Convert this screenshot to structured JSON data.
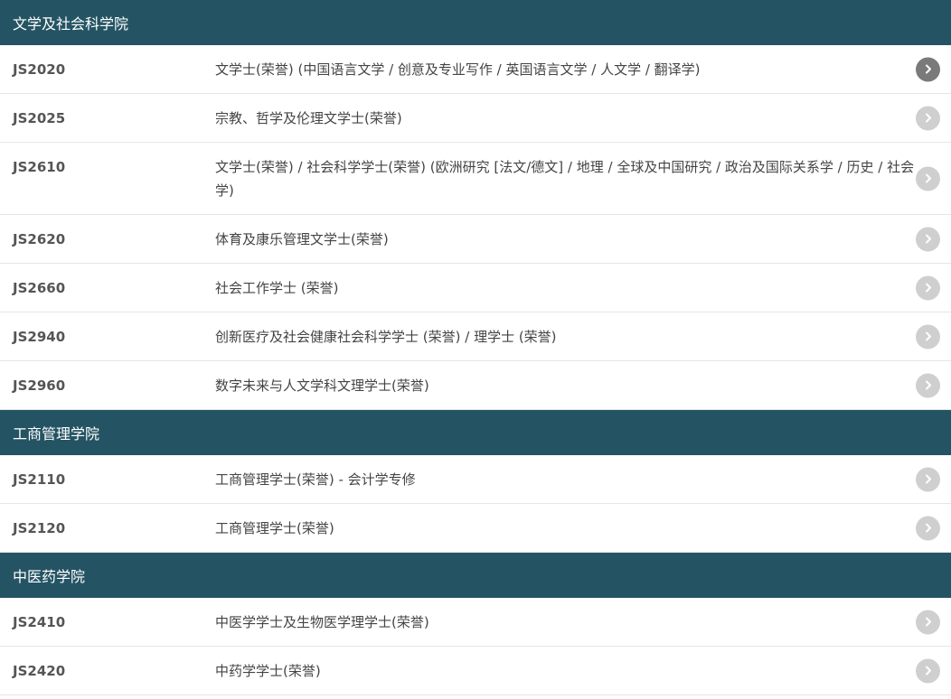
{
  "sections": [
    {
      "title": "文学及社会科学院",
      "items": [
        {
          "code": "JS2020",
          "title": "文学士(荣誉) (中国语言文学 / 创意及专业写作 / 英国语言文学 / 人文学 / 翻译学)"
        },
        {
          "code": "JS2025",
          "title": "宗教、哲学及伦理文学士(荣誉)"
        },
        {
          "code": "JS2610",
          "title": "文学士(荣誉) / 社会科学学士(荣誉) (欧洲研究 [法文/德文] / 地理 / 全球及中国研究 / 政治及国际关系学 / 历史 / 社会学)"
        },
        {
          "code": "JS2620",
          "title": "体育及康乐管理文学士(荣誉)"
        },
        {
          "code": "JS2660",
          "title": "社会工作学士 (荣誉)"
        },
        {
          "code": "JS2940",
          "title": "创新医疗及社会健康社会科学学士 (荣誉) / 理学士 (荣誉)"
        },
        {
          "code": "JS2960",
          "title": "数字未来与人文学科文理学士(荣誉)"
        }
      ]
    },
    {
      "title": "工商管理学院",
      "items": [
        {
          "code": "JS2110",
          "title": "工商管理学士(荣誉) - 会计学专修"
        },
        {
          "code": "JS2120",
          "title": "工商管理学士(荣誉)"
        }
      ]
    },
    {
      "title": "中医药学院",
      "items": [
        {
          "code": "JS2410",
          "title": "中医学学士及生物医学理学士(荣誉)"
        },
        {
          "code": "JS2420",
          "title": "中药学学士(荣誉)"
        }
      ]
    }
  ],
  "icons": {
    "row_action": "chevron-right-icon"
  },
  "colors": {
    "section_header_bg": "#245463",
    "chevron_default": "#cfcfcf",
    "chevron_active": "#7a7a7a"
  }
}
